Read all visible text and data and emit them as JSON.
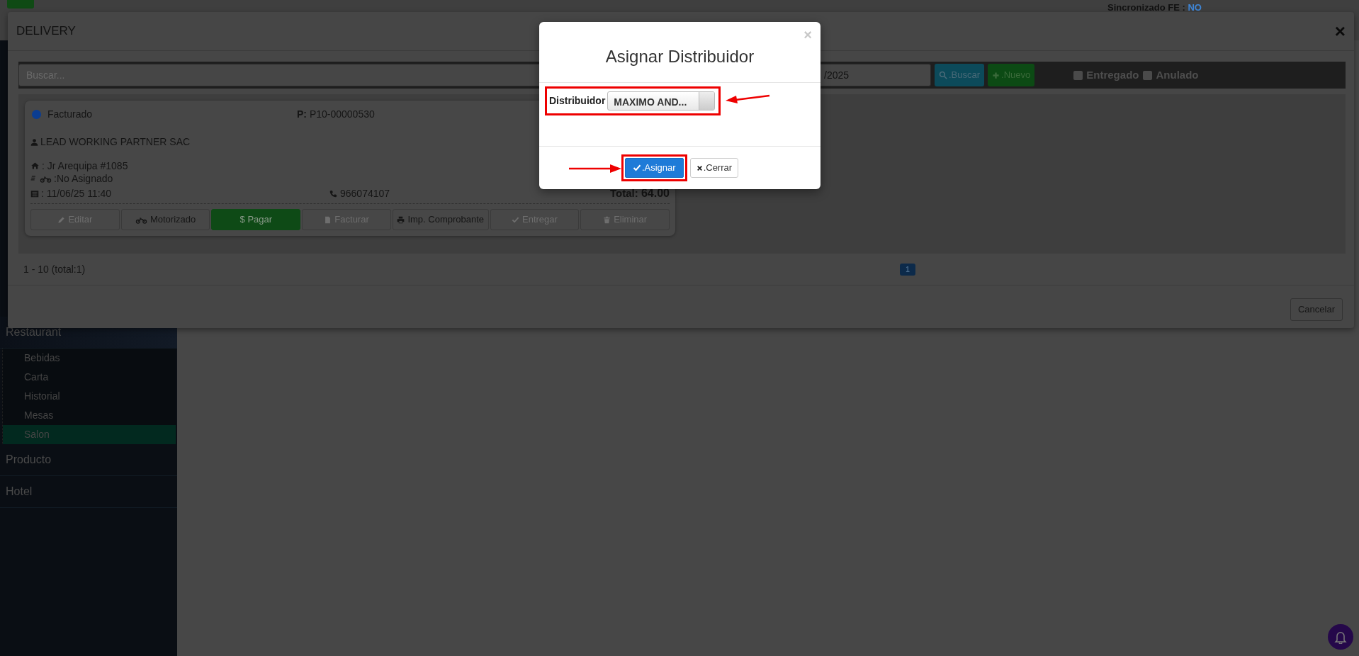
{
  "header": {
    "sync_label": "Sincronizado FE :",
    "sync_value": "NO"
  },
  "sidebar": {
    "items": [
      {
        "label": "Restaurant",
        "expanded": true,
        "children": [
          {
            "label": "Bebidas",
            "selected": false
          },
          {
            "label": "Carta",
            "selected": false
          },
          {
            "label": "Historial",
            "selected": false
          },
          {
            "label": "Mesas",
            "selected": false
          },
          {
            "label": "Salon",
            "selected": true
          }
        ]
      },
      {
        "label": "Producto",
        "expanded": false
      },
      {
        "label": "Hotel",
        "expanded": false
      }
    ]
  },
  "delivery_modal": {
    "title": "DELIVERY",
    "close": "×",
    "search": {
      "placeholder": "Buscar..."
    },
    "date_field": {
      "value": "/2025"
    },
    "buttons": [
      {
        "label": ".Buscar",
        "kind": "search"
      },
      {
        "label": ".Nuevo",
        "kind": "new"
      }
    ],
    "filters": [
      {
        "label": "Entregado",
        "checked": false
      },
      {
        "label": "Anulado",
        "checked": false
      }
    ],
    "orders": [
      {
        "status": "Facturado",
        "color": "#0b3d91",
        "code_label": "P:",
        "code": "P10-00000530",
        "customer": "LEAD WORKING PARTNER SAC",
        "address": ": Jr Arequipa #1085",
        "driver": ":No Asignado",
        "date": ": 11/06/25 11:40",
        "phone": "966074107",
        "total_label": "Total:",
        "total": "64.00",
        "actions": [
          {
            "label": "Editar",
            "kind": "edit",
            "disabled": true
          },
          {
            "label": "Motorizado",
            "kind": "moto",
            "disabled": false
          },
          {
            "label": "$ Pagar",
            "kind": "pay",
            "disabled": false
          },
          {
            "label": "Facturar",
            "kind": "invoice",
            "disabled": true
          },
          {
            "label": "Imp. Comprobante",
            "kind": "print",
            "disabled": false
          },
          {
            "label": "Entregar",
            "kind": "deliver",
            "disabled": true
          },
          {
            "label": "Eliminar",
            "kind": "delete",
            "disabled": true
          }
        ]
      }
    ],
    "range": "1 - 10 (total:1)",
    "pages": [
      {
        "label": "1",
        "selected": true
      }
    ],
    "footer_button": "Cancelar"
  },
  "assign_modal": {
    "title": "Asignar Distribuidor",
    "close": "×",
    "field_label": "Distribuidor",
    "selected_value": "MAXIMO AND...",
    "buttons": [
      {
        "label": ".Asignar",
        "kind": "primary"
      },
      {
        "label": ".Cerrar",
        "kind": "close"
      }
    ]
  }
}
